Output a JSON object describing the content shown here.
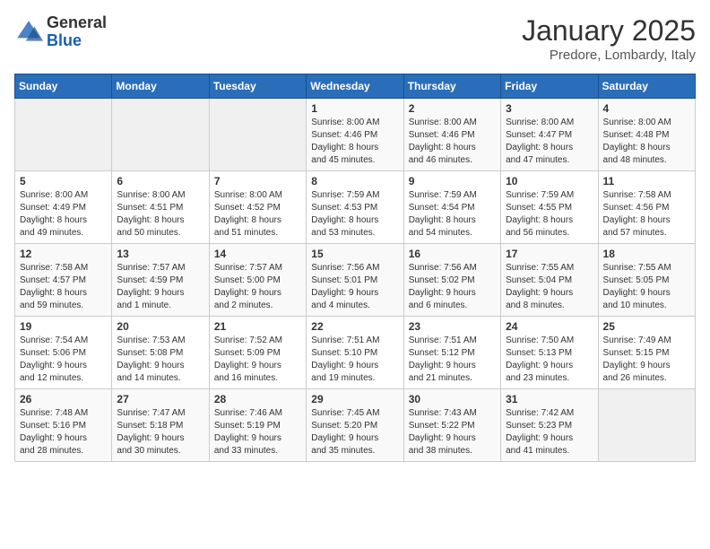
{
  "header": {
    "logo_general": "General",
    "logo_blue": "Blue",
    "month_title": "January 2025",
    "location": "Predore, Lombardy, Italy"
  },
  "days_of_week": [
    "Sunday",
    "Monday",
    "Tuesday",
    "Wednesday",
    "Thursday",
    "Friday",
    "Saturday"
  ],
  "weeks": [
    [
      {
        "day": "",
        "info": ""
      },
      {
        "day": "",
        "info": ""
      },
      {
        "day": "",
        "info": ""
      },
      {
        "day": "1",
        "info": "Sunrise: 8:00 AM\nSunset: 4:46 PM\nDaylight: 8 hours\nand 45 minutes."
      },
      {
        "day": "2",
        "info": "Sunrise: 8:00 AM\nSunset: 4:46 PM\nDaylight: 8 hours\nand 46 minutes."
      },
      {
        "day": "3",
        "info": "Sunrise: 8:00 AM\nSunset: 4:47 PM\nDaylight: 8 hours\nand 47 minutes."
      },
      {
        "day": "4",
        "info": "Sunrise: 8:00 AM\nSunset: 4:48 PM\nDaylight: 8 hours\nand 48 minutes."
      }
    ],
    [
      {
        "day": "5",
        "info": "Sunrise: 8:00 AM\nSunset: 4:49 PM\nDaylight: 8 hours\nand 49 minutes."
      },
      {
        "day": "6",
        "info": "Sunrise: 8:00 AM\nSunset: 4:51 PM\nDaylight: 8 hours\nand 50 minutes."
      },
      {
        "day": "7",
        "info": "Sunrise: 8:00 AM\nSunset: 4:52 PM\nDaylight: 8 hours\nand 51 minutes."
      },
      {
        "day": "8",
        "info": "Sunrise: 7:59 AM\nSunset: 4:53 PM\nDaylight: 8 hours\nand 53 minutes."
      },
      {
        "day": "9",
        "info": "Sunrise: 7:59 AM\nSunset: 4:54 PM\nDaylight: 8 hours\nand 54 minutes."
      },
      {
        "day": "10",
        "info": "Sunrise: 7:59 AM\nSunset: 4:55 PM\nDaylight: 8 hours\nand 56 minutes."
      },
      {
        "day": "11",
        "info": "Sunrise: 7:58 AM\nSunset: 4:56 PM\nDaylight: 8 hours\nand 57 minutes."
      }
    ],
    [
      {
        "day": "12",
        "info": "Sunrise: 7:58 AM\nSunset: 4:57 PM\nDaylight: 8 hours\nand 59 minutes."
      },
      {
        "day": "13",
        "info": "Sunrise: 7:57 AM\nSunset: 4:59 PM\nDaylight: 9 hours\nand 1 minute."
      },
      {
        "day": "14",
        "info": "Sunrise: 7:57 AM\nSunset: 5:00 PM\nDaylight: 9 hours\nand 2 minutes."
      },
      {
        "day": "15",
        "info": "Sunrise: 7:56 AM\nSunset: 5:01 PM\nDaylight: 9 hours\nand 4 minutes."
      },
      {
        "day": "16",
        "info": "Sunrise: 7:56 AM\nSunset: 5:02 PM\nDaylight: 9 hours\nand 6 minutes."
      },
      {
        "day": "17",
        "info": "Sunrise: 7:55 AM\nSunset: 5:04 PM\nDaylight: 9 hours\nand 8 minutes."
      },
      {
        "day": "18",
        "info": "Sunrise: 7:55 AM\nSunset: 5:05 PM\nDaylight: 9 hours\nand 10 minutes."
      }
    ],
    [
      {
        "day": "19",
        "info": "Sunrise: 7:54 AM\nSunset: 5:06 PM\nDaylight: 9 hours\nand 12 minutes."
      },
      {
        "day": "20",
        "info": "Sunrise: 7:53 AM\nSunset: 5:08 PM\nDaylight: 9 hours\nand 14 minutes."
      },
      {
        "day": "21",
        "info": "Sunrise: 7:52 AM\nSunset: 5:09 PM\nDaylight: 9 hours\nand 16 minutes."
      },
      {
        "day": "22",
        "info": "Sunrise: 7:51 AM\nSunset: 5:10 PM\nDaylight: 9 hours\nand 19 minutes."
      },
      {
        "day": "23",
        "info": "Sunrise: 7:51 AM\nSunset: 5:12 PM\nDaylight: 9 hours\nand 21 minutes."
      },
      {
        "day": "24",
        "info": "Sunrise: 7:50 AM\nSunset: 5:13 PM\nDaylight: 9 hours\nand 23 minutes."
      },
      {
        "day": "25",
        "info": "Sunrise: 7:49 AM\nSunset: 5:15 PM\nDaylight: 9 hours\nand 26 minutes."
      }
    ],
    [
      {
        "day": "26",
        "info": "Sunrise: 7:48 AM\nSunset: 5:16 PM\nDaylight: 9 hours\nand 28 minutes."
      },
      {
        "day": "27",
        "info": "Sunrise: 7:47 AM\nSunset: 5:18 PM\nDaylight: 9 hours\nand 30 minutes."
      },
      {
        "day": "28",
        "info": "Sunrise: 7:46 AM\nSunset: 5:19 PM\nDaylight: 9 hours\nand 33 minutes."
      },
      {
        "day": "29",
        "info": "Sunrise: 7:45 AM\nSunset: 5:20 PM\nDaylight: 9 hours\nand 35 minutes."
      },
      {
        "day": "30",
        "info": "Sunrise: 7:43 AM\nSunset: 5:22 PM\nDaylight: 9 hours\nand 38 minutes."
      },
      {
        "day": "31",
        "info": "Sunrise: 7:42 AM\nSunset: 5:23 PM\nDaylight: 9 hours\nand 41 minutes."
      },
      {
        "day": "",
        "info": ""
      }
    ]
  ]
}
